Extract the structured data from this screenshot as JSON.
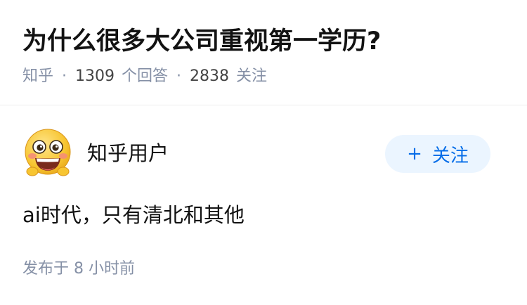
{
  "question": {
    "title": "为什么很多大公司重视第一学历?",
    "source": "知乎",
    "separator": "·",
    "answer_count": "1309",
    "answer_label": "个回答",
    "follower_count": "2838",
    "follower_label": "关注"
  },
  "answer": {
    "author": {
      "name": "知乎用户",
      "avatar_icon": "grinning-emoji-avatar-icon"
    },
    "follow_button": {
      "icon": "plus-icon",
      "plus": "+",
      "label": "关注"
    },
    "content": "ai时代，只有清北和其他",
    "published_label": "发布于",
    "published_time": "8 小时前"
  },
  "colors": {
    "title": "#121212",
    "meta": "#8590a6",
    "accent": "#056de8",
    "button_bg": "#ebf5ff",
    "divider": "#ededed"
  }
}
